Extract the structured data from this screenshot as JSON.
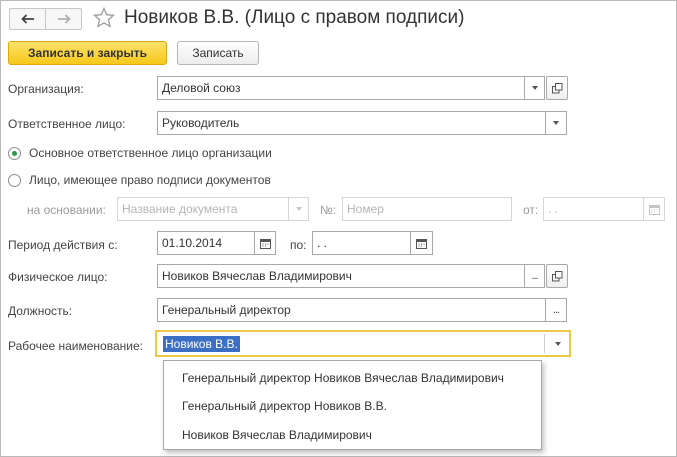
{
  "window": {
    "title": "Новиков В.В. (Лицо с правом подписи)"
  },
  "toolbar": {
    "save_close_label": "Записать и закрыть",
    "save_label": "Записать"
  },
  "form": {
    "organization": {
      "label": "Организация:",
      "value": "Деловой союз"
    },
    "responsible": {
      "label": "Ответственное лицо:",
      "value": "Руководитель"
    },
    "radio_main": {
      "label": "Основное ответственное лицо организации",
      "checked": true
    },
    "radio_sign": {
      "label": "Лицо, имеющее право подписи документов",
      "checked": false
    },
    "basis": {
      "label": "на основании:",
      "placeholder": "Название документа",
      "number_label": "№:",
      "number_placeholder": "Номер",
      "from_label": "от:",
      "from_value": " .  . "
    },
    "period": {
      "label": "Период действия с:",
      "from_value": "01.10.2014",
      "to_label": "по:",
      "to_value": " .  . "
    },
    "person": {
      "label": "Физическое лицо:",
      "value": "Новиков Вячеслав Владимирович"
    },
    "position": {
      "label": "Должность:",
      "value": "Генеральный директор"
    },
    "working_name": {
      "label": "Рабочее наименование:",
      "value": "Новиков В.В."
    }
  },
  "dropdown": {
    "items": [
      "Генеральный директор Новиков Вячеслав Владимирович",
      "Генеральный директор Новиков В.В.",
      "Новиков Вячеслав Владимирович"
    ]
  },
  "colors": {
    "primary_button": "#f6c81a",
    "focus_border": "#f0c845",
    "selection": "#3b6fc5",
    "radio_dot": "#2b9a47"
  },
  "icons": [
    "arrow-left-icon",
    "arrow-right-icon",
    "star-icon",
    "caret-down-icon",
    "open-icon",
    "calendar-icon",
    "ellipsis-icon"
  ]
}
